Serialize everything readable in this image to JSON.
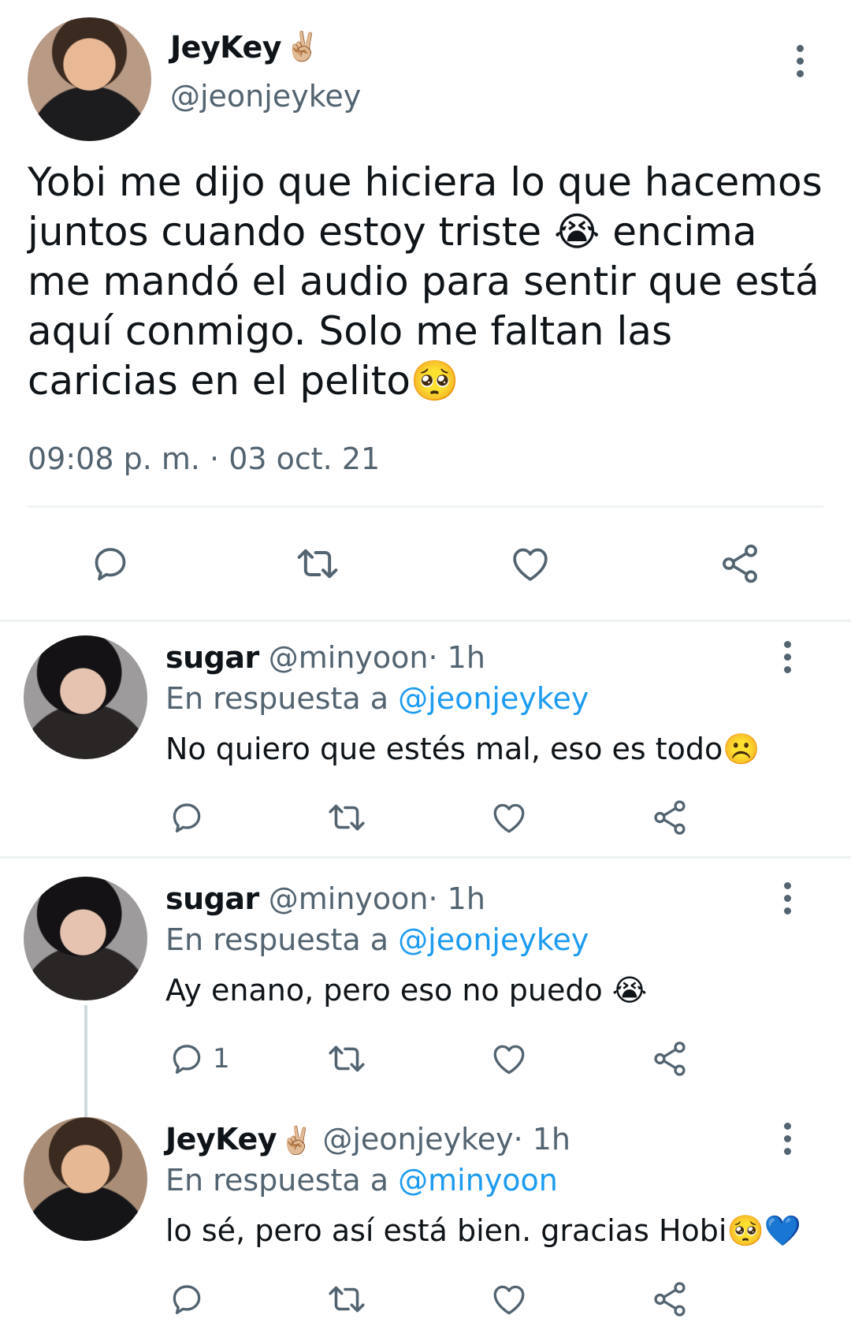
{
  "main_tweet": {
    "name": "JeyKey",
    "name_emoji": "✌🏼",
    "handle": "@jeonjeykey",
    "text": "Yobi me dijo que hiciera lo que hacemos juntos cuando estoy triste 😭 encima me mandó el audio para sentir que está aquí conmigo. Solo me faltan las caricias en el pelito🥺",
    "timestamp": "09:08 p. m. · 03 oct. 21",
    "icons": [
      "reply-icon",
      "retweet-icon",
      "like-icon",
      "share-icon",
      "more-icon"
    ]
  },
  "replies": [
    {
      "name": "sugar",
      "name_emoji": "",
      "handle": "@minyoon",
      "time": " · 1h",
      "reply_prefix": "En respuesta a ",
      "reply_to": "@jeonjeykey",
      "text": "No quiero que estés mal, eso es todo☹️",
      "reply_count": ""
    },
    {
      "name": "sugar",
      "name_emoji": "",
      "handle": "@minyoon",
      "time": " · 1h",
      "reply_prefix": "En respuesta a ",
      "reply_to": "@jeonjeykey",
      "text": "Ay enano, pero eso no puedo 😭",
      "reply_count": "1"
    },
    {
      "name": "JeyKey",
      "name_emoji": "✌🏼",
      "handle": "@jeonjeykey",
      "time": " · 1h",
      "reply_prefix": "En respuesta a ",
      "reply_to": "@minyoon",
      "text": "lo sé, pero así está bien. gracias Hobi🥺💙",
      "reply_count": ""
    }
  ],
  "colors": {
    "text": "#0f1419",
    "secondary": "#536471",
    "link": "#1d9bf0",
    "divider": "#eff3f4"
  }
}
